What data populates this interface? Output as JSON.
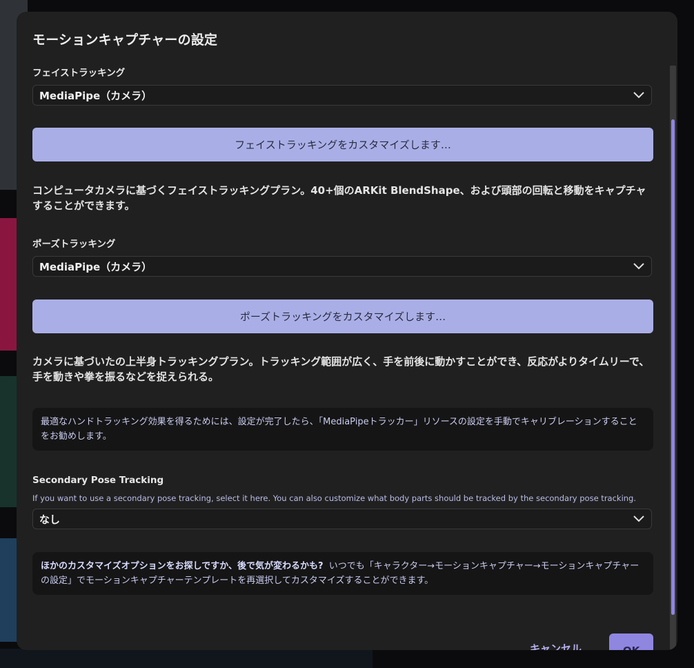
{
  "dialog": {
    "title": "モーションキャプチャーの設定"
  },
  "face_tracking": {
    "label": "フェイストラッキング",
    "selected": "MediaPipe（カメラ）",
    "customize_label": "フェイストラッキングをカスタマイズします…",
    "description": "コンピュータカメラに基づくフェイストラッキングプラン。40+個のARKit BlendShape、および頭部の回転と移動をキャプチャすることができます。"
  },
  "pose_tracking": {
    "label": "ポーズトラッキング",
    "selected": "MediaPipe（カメラ）",
    "customize_label": "ポーズトラッキングをカスタマイズします…",
    "description": "カメラに基づいたの上半身トラッキングプラン。トラッキング範囲が広く、手を前後に動かすことができ、反応がよりタイムリーで、手を動きや拳を振るなどを捉えられる。"
  },
  "hand_note": "最適なハンドトラッキング効果を得るためには、設定が完了したら、「MediaPipeトラッカー」リソースの設定を手動でキャリブレーションすることをお勧めします。",
  "secondary_pose": {
    "label": "Secondary Pose Tracking",
    "help": "If you want to use a secondary pose tracking, select it here. You can also customize what body parts should be tracked by the secondary pose tracking.",
    "selected": "なし"
  },
  "tip": {
    "bold": "ほかのカスタマイズオプションをお探しですか、後で気が変わるかも?",
    "text": "いつでも「キャラクター→モーションキャプチャー→モーションキャプチャーの設定」でモーションキャプチャーテンプレートを再選択してカスタマイズすることができます。"
  },
  "footer": {
    "cancel_label": "キャンセル",
    "ok_label": "OK"
  },
  "colors": {
    "dialog_bg": "#202020",
    "button_bg": "#a9afe6",
    "accent": "#8f86e0",
    "note_text": "#c9ccf0"
  },
  "icons": {
    "dropdown": "chevron-down-icon"
  }
}
